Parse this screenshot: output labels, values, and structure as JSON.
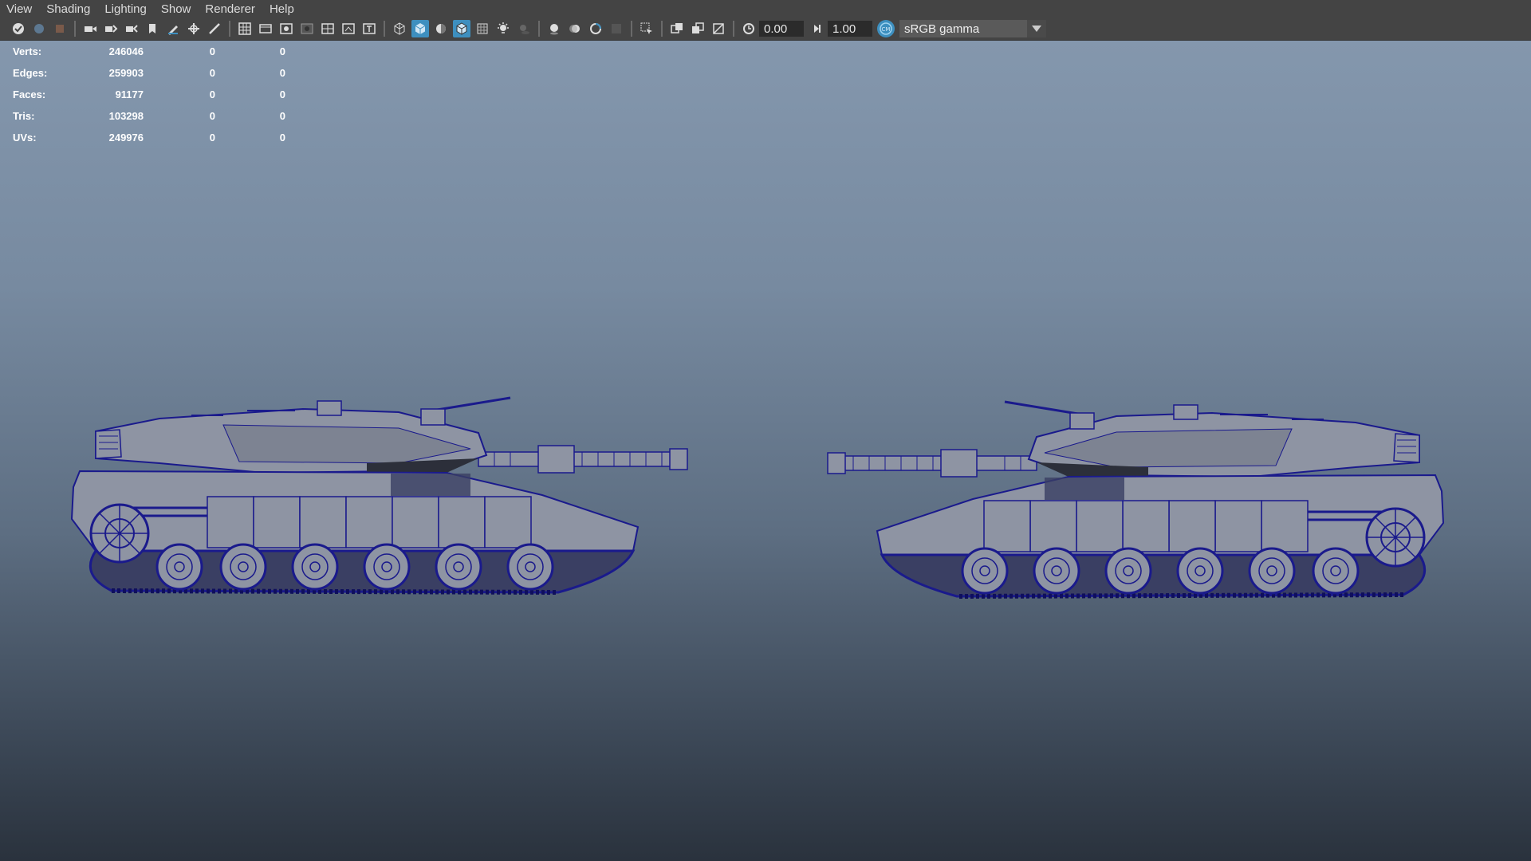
{
  "menubar": {
    "items": [
      "View",
      "Shading",
      "Lighting",
      "Show",
      "Renderer",
      "Help"
    ]
  },
  "toolbar": {
    "exposure": "0.00",
    "gamma": "1.00",
    "color_space": "sRGB gamma",
    "icons": [
      "select-camera-icon",
      "camera-attributes-icon",
      "bookmark-icon",
      "image-plane-icon",
      "grid-icon",
      "film-gate-icon",
      "resolution-gate-icon",
      "gate-mask-icon",
      "field-chart-icon",
      "safe-action-icon",
      "safe-title-icon",
      "wireframe-icon",
      "smooth-shade-icon",
      "default-material-icon",
      "wireframe-on-shaded-icon",
      "xray-icon",
      "use-all-lights-icon",
      "shadows-icon",
      "screen-space-ao-icon",
      "motion-blur-icon",
      "antialiasing-icon",
      "depth-of-field-icon",
      "isolate-select-icon",
      "xray-joints-icon",
      "exposure-icon",
      "gamma-icon",
      "color-management-icon"
    ],
    "accent_color": "#3d8fbf"
  },
  "hud": {
    "rows": [
      {
        "label": "Verts:",
        "value": "246046",
        "sel1": "0",
        "sel2": "0"
      },
      {
        "label": "Edges:",
        "value": "259903",
        "sel1": "0",
        "sel2": "0"
      },
      {
        "label": "Faces:",
        "value": "91177",
        "sel1": "0",
        "sel2": "0"
      },
      {
        "label": "Tris:",
        "value": "103298",
        "sel1": "0",
        "sel2": "0"
      },
      {
        "label": "UVs:",
        "value": "249976",
        "sel1": "0",
        "sel2": "0"
      }
    ]
  },
  "viewport": {
    "wireframe_color": "#1a1a8c",
    "hull_color": "#8e94a3"
  }
}
